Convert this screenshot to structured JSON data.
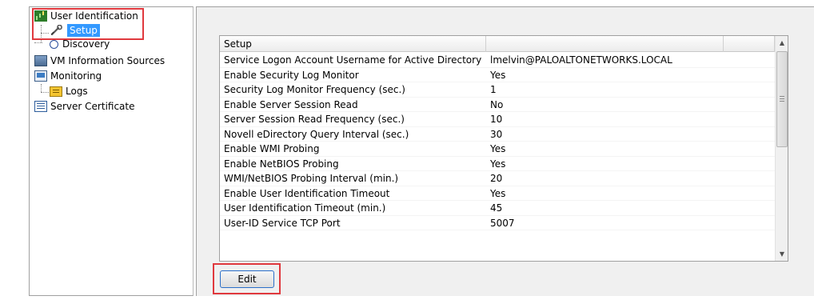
{
  "colors": {
    "selection": "#3399ff",
    "annotation": "#e0393e",
    "button_border": "#2b6fc9"
  },
  "tree": {
    "items": [
      {
        "label": "User Identification",
        "icon": "user-id-icon"
      },
      {
        "label": "Setup",
        "icon": "wrench-icon",
        "selected": true
      },
      {
        "label": "Discovery",
        "icon": "discovery-icon"
      },
      {
        "label": "VM Information Sources",
        "icon": "vm-icon"
      },
      {
        "label": "Monitoring",
        "icon": "monitor-icon"
      },
      {
        "label": "Logs",
        "icon": "logs-icon"
      },
      {
        "label": "Server Certificate",
        "icon": "certificate-icon"
      }
    ]
  },
  "grid": {
    "headers": [
      "Setup",
      "",
      ""
    ],
    "rows": [
      {
        "name": "Service Logon Account Username for Active Directory",
        "value": "lmelvin@PALOALTONETWORKS.LOCAL"
      },
      {
        "name": "Enable Security Log Monitor",
        "value": "Yes"
      },
      {
        "name": "Security Log Monitor Frequency (sec.)",
        "value": "1"
      },
      {
        "name": "Enable Server Session Read",
        "value": "No"
      },
      {
        "name": "Server Session Read Frequency (sec.)",
        "value": "10"
      },
      {
        "name": "Novell eDirectory Query Interval (sec.)",
        "value": "30"
      },
      {
        "name": "Enable WMI Probing",
        "value": "Yes"
      },
      {
        "name": "Enable NetBIOS Probing",
        "value": "Yes"
      },
      {
        "name": "WMI/NetBIOS Probing Interval (min.)",
        "value": "20"
      },
      {
        "name": "Enable User Identification Timeout",
        "value": "Yes"
      },
      {
        "name": "User Identification Timeout (min.)",
        "value": "45"
      },
      {
        "name": "User-ID Service TCP Port",
        "value": "5007"
      }
    ]
  },
  "scrollbar": {
    "up": "▲",
    "down": "▼",
    "grip": "≡"
  },
  "actions": {
    "edit_label": "Edit"
  }
}
